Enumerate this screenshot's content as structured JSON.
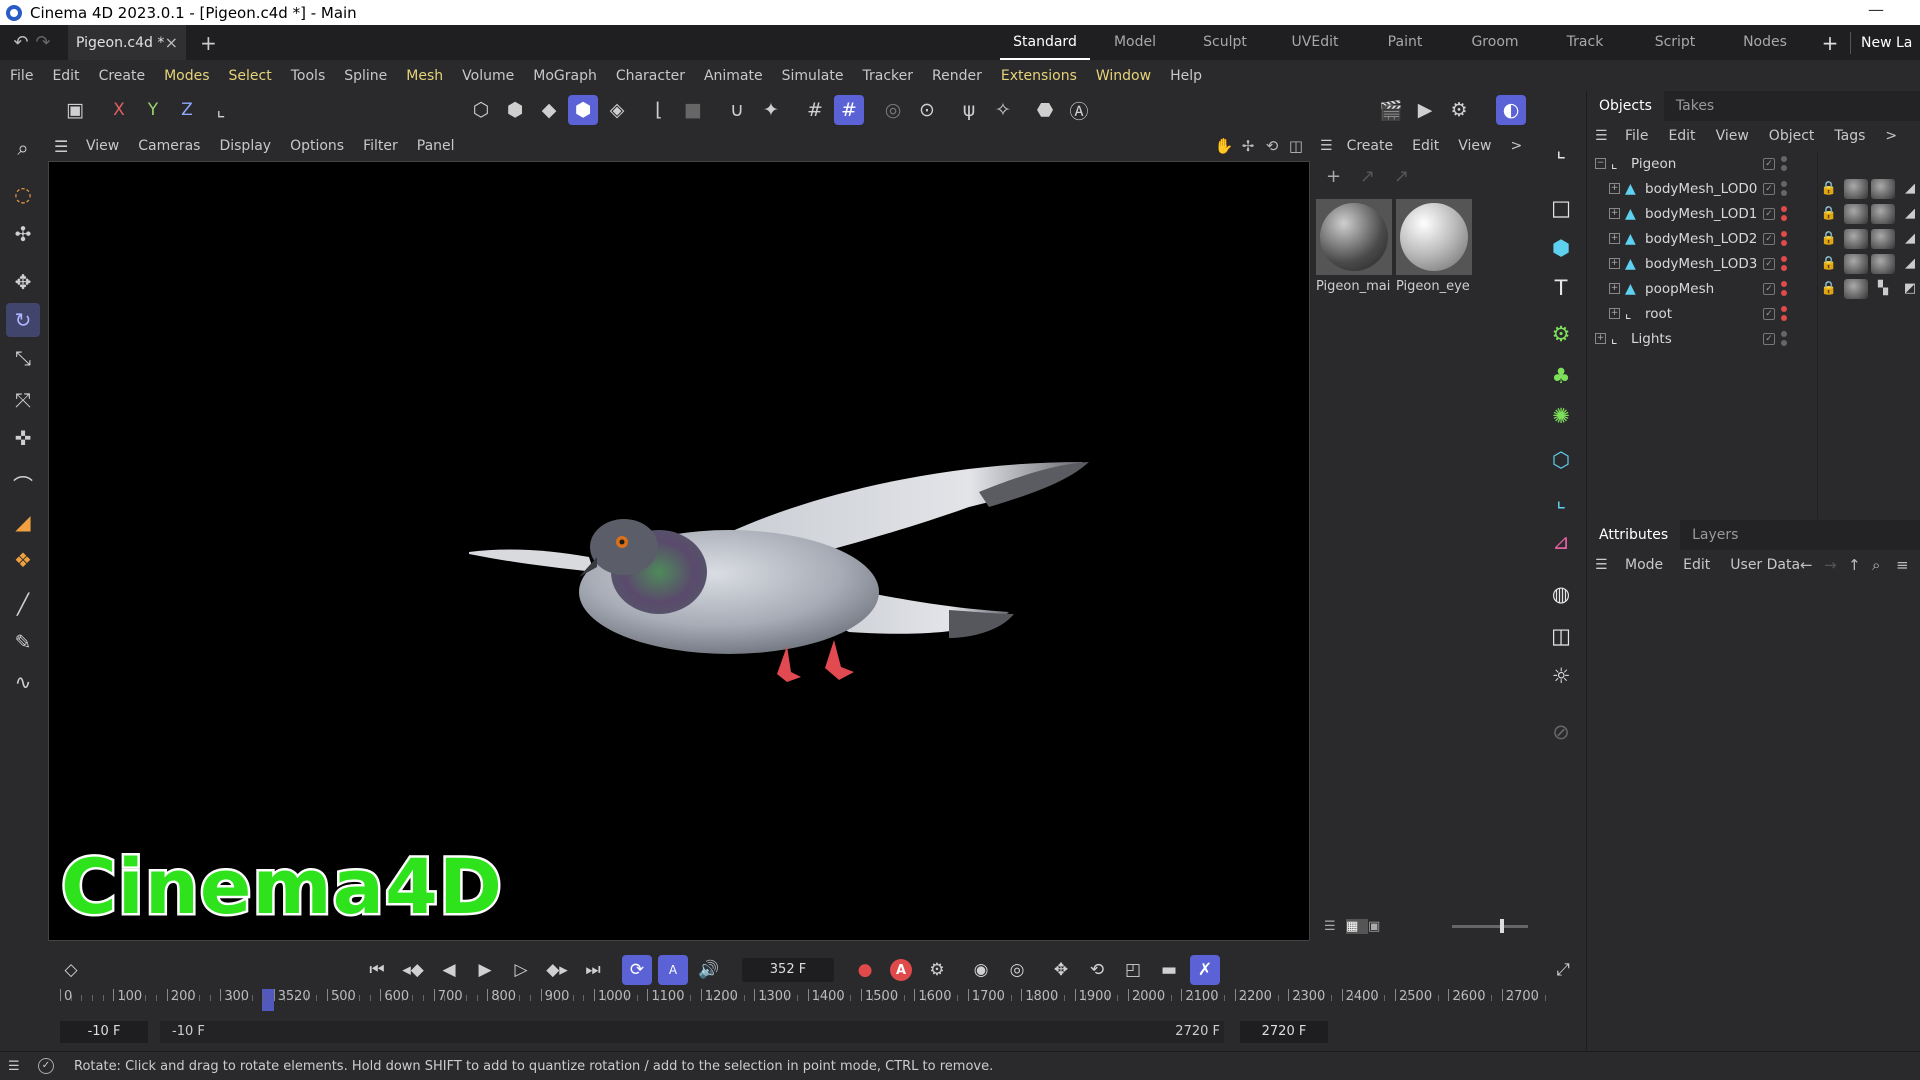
{
  "window": {
    "title": "Cinema 4D 2023.0.1 - [Pigeon.c4d *] - Main",
    "min": "—"
  },
  "doc_tab": {
    "label": "Pigeon.c4d *",
    "close": "×",
    "add": "+"
  },
  "layouts": {
    "items": [
      "Standard",
      "Model",
      "Sculpt",
      "UVEdit",
      "Paint",
      "Groom",
      "Track",
      "Script",
      "Nodes"
    ],
    "active": "Standard",
    "plus": "+",
    "new_layout": "New La"
  },
  "menu": [
    "File",
    "Edit",
    "Create",
    "Modes",
    "Select",
    "Tools",
    "Spline",
    "Mesh",
    "Volume",
    "MoGraph",
    "Character",
    "Animate",
    "Simulate",
    "Tracker",
    "Render",
    "Extensions",
    "Window",
    "Help"
  ],
  "toolbar": {
    "axis": [
      "X",
      "Y",
      "Z"
    ]
  },
  "viewport": {
    "menu": [
      "View",
      "Cameras",
      "Display",
      "Options",
      "Filter",
      "Panel"
    ],
    "logo_text": "Cinema4D"
  },
  "material_manager": {
    "menu": [
      "Create",
      "Edit",
      "View"
    ],
    "more": ">",
    "materials": [
      {
        "name": "Pigeon_mai"
      },
      {
        "name": "Pigeon_eye"
      }
    ]
  },
  "objects_panel": {
    "tabs": [
      "Objects",
      "Takes"
    ],
    "menu": [
      "File",
      "Edit",
      "View",
      "Object",
      "Tags"
    ],
    "more": ">",
    "objects": [
      {
        "name": "Pigeon",
        "level": 0,
        "icon": "null"
      },
      {
        "name": "bodyMesh_LOD0",
        "level": 1,
        "icon": "mesh"
      },
      {
        "name": "bodyMesh_LOD1",
        "level": 1,
        "icon": "mesh"
      },
      {
        "name": "bodyMesh_LOD2",
        "level": 1,
        "icon": "mesh"
      },
      {
        "name": "bodyMesh_LOD3",
        "level": 1,
        "icon": "mesh"
      },
      {
        "name": "poopMesh",
        "level": 1,
        "icon": "mesh"
      },
      {
        "name": "root",
        "level": 1,
        "icon": "null"
      },
      {
        "name": "Lights",
        "level": 0,
        "icon": "null"
      }
    ]
  },
  "attributes_panel": {
    "tabs": [
      "Attributes",
      "Layers"
    ],
    "menu": [
      "Mode",
      "Edit",
      "User Data"
    ]
  },
  "timeline": {
    "current_frame": "352 F",
    "ticks": [
      "0",
      "100",
      "200",
      "300",
      "3520",
      "500",
      "600",
      "700",
      "800",
      "900",
      "1000",
      "1100",
      "1200",
      "1300",
      "1400",
      "1500",
      "1600",
      "1700",
      "1800",
      "1900",
      "2000",
      "2100",
      "2200",
      "2300",
      "2400",
      "2500",
      "2600",
      "2700"
    ],
    "range_start": "-10 F",
    "range_start_bar": "-10 F",
    "range_end_bar": "2720 F",
    "range_end": "2720 F",
    "auto_key": "A"
  },
  "status": {
    "message": "Rotate: Click and drag to rotate elements. Hold down SHIFT to add to quantize rotation / add to the selection in point mode, CTRL to remove."
  }
}
